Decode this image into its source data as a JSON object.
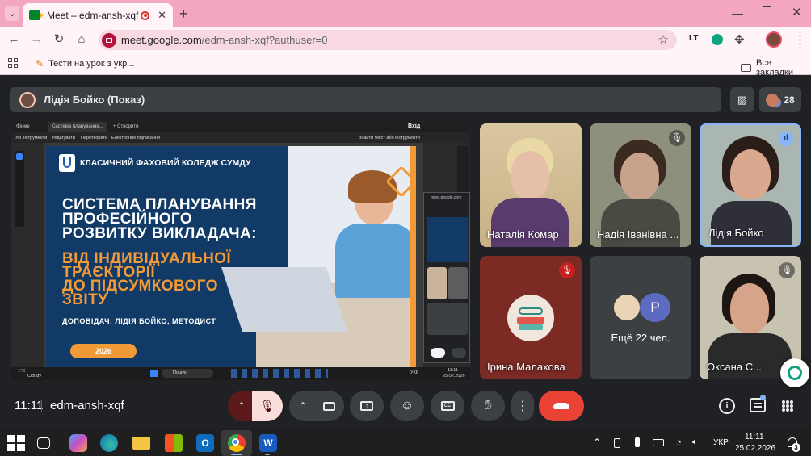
{
  "browser": {
    "tab_title": "Meet – edm-ansh-xqf",
    "url_host": "meet.google.com",
    "url_path": "/edm-ansh-xqf?authuser=0",
    "bookmark": "Тести на урок з укр...",
    "all_bookmarks": "Все закладки",
    "new_tab_icon": "+"
  },
  "meet": {
    "presenter_label": "Лідія Бойко (Показ)",
    "participant_count": "28",
    "clock": "11:11",
    "meeting_code": "edm-ansh-xqf",
    "notification_count": "1",
    "more_people": "Ещё 22 чел.",
    "more_people_avatar_letter": "P",
    "participants": [
      {
        "name": "Наталія Комар",
        "muted": false
      },
      {
        "name": "Надія Іванівна ...",
        "muted": true
      },
      {
        "name": "Лідія Бойко",
        "muted": false,
        "speaking": true
      },
      {
        "name": "Ірина Малахова",
        "muted": true
      },
      {
        "name": "Оксана С...",
        "muted": true
      }
    ]
  },
  "shared_screen": {
    "app_tabs": [
      "Фінме",
      "Система планування...",
      "+ Створити"
    ],
    "app_brand": "Вхід",
    "menu": [
      "Усі інструменти",
      "Редагувати",
      "Перетворити",
      "Електронне підписання"
    ],
    "search_hint": "Знайти текст або інструменти",
    "college": "КЛАСИЧНИЙ ФАХОВИЙ КОЛЕДЖ СУМДУ",
    "title_lines": [
      "СИСТЕМА ПЛАНУВАННЯ",
      "ПРОФЕСІЙНОГО",
      "РОЗВИТКУ ВИКЛАДАЧА:"
    ],
    "subtitle_lines": [
      "ВІД ІНДИВІДУАЛЬНОЇ",
      "ТРАЄКТОРІЇ",
      "ДО ПІДСУМКОВОГО",
      "ЗВІТУ"
    ],
    "speaker": "ДОПОВІДАЧ: ЛІДІЯ БОЙКО, МЕТОДИСТ",
    "year": "2026",
    "mini_url": "meet.google.com",
    "weather_temp": "1°C",
    "weather_text": "Cloudy",
    "search_label": "Пошук",
    "lang": "УКР",
    "time": "11:11",
    "date": "25.02.2026"
  },
  "taskbar": {
    "lang": "УКР",
    "time": "11:11",
    "date": "25.02.2026",
    "notif": "3"
  },
  "colors": {
    "chrome_pink": "#f2a7bf",
    "meet_bg": "#202124",
    "end_call": "#ea4335",
    "slide_navy": "#123a66",
    "slide_orange": "#f29a37"
  }
}
